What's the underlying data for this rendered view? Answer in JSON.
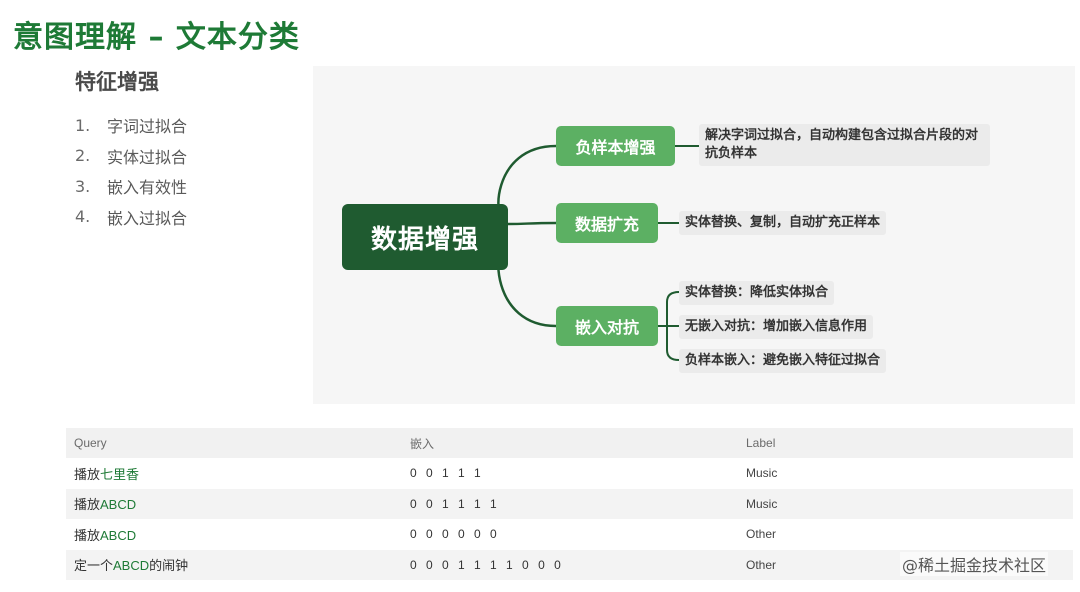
{
  "slide": {
    "title": "意图理解 – 文本分类"
  },
  "features": {
    "title": "特征增强",
    "items": [
      {
        "num": "1.",
        "label": "字词过拟合"
      },
      {
        "num": "2.",
        "label": "实体过拟合"
      },
      {
        "num": "3.",
        "label": "嵌入有效性"
      },
      {
        "num": "4.",
        "label": "嵌入过拟合"
      }
    ]
  },
  "mindmap": {
    "root": "数据增强",
    "branches": [
      {
        "label": "负样本增强",
        "leaves": [
          "解决字词过拟合，自动构建包含过拟合片段的对",
          "抗负样本"
        ]
      },
      {
        "label": "数据扩充",
        "leaves": [
          "实体替换、复制，自动扩充正样本"
        ]
      },
      {
        "label": "嵌入对抗",
        "leaves": [
          "实体替换：降低实体拟合",
          "无嵌入对抗：增加嵌入信息作用",
          "负样本嵌入：避免嵌入特征过拟合"
        ]
      }
    ],
    "colors": {
      "root": "#1f5b30",
      "branch": "#5cb063",
      "line": "#1f5b30"
    }
  },
  "table": {
    "headers": [
      "Query",
      "嵌入",
      "Label"
    ],
    "rows": [
      {
        "prefix": "播放",
        "entity": "七里香",
        "suffix": "",
        "embedding": "0 0 1 1 1",
        "label": "Music"
      },
      {
        "prefix": "播放",
        "entity": "ABCD",
        "suffix": "",
        "embedding": "0 0 1 1 1 1",
        "label": "Music"
      },
      {
        "prefix": "播放",
        "entity": "ABCD",
        "suffix": "",
        "embedding": "0 0 0 0 0 0",
        "label": "Other"
      },
      {
        "prefix": "定一个",
        "entity": "ABCD",
        "suffix": "的闹钟",
        "embedding": "0 0 0 1 1 1 1 0 0 0",
        "label": "Other"
      }
    ]
  },
  "watermark": "@稀土掘金技术社区"
}
